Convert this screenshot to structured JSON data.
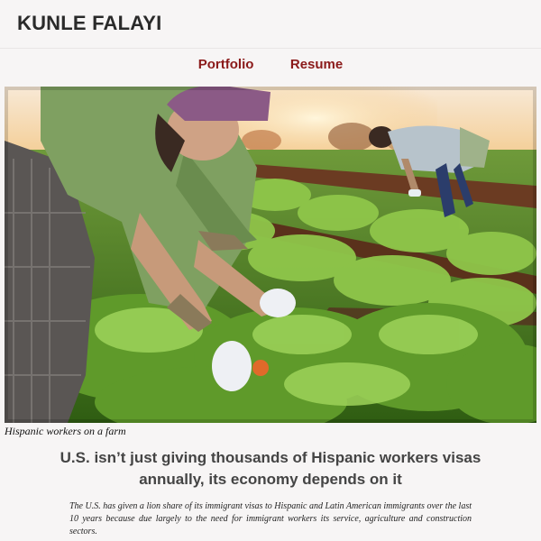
{
  "site": {
    "title": "KUNLE FALAYI"
  },
  "nav": {
    "items": [
      {
        "label": "Portfolio"
      },
      {
        "label": "Resume"
      }
    ]
  },
  "article": {
    "image_caption": "Hispanic workers on a farm",
    "headline": "U.S. isn’t just giving thousands of Hispanic workers visas annually, its economy depends on it",
    "lede": "The U.S. has given a lion share of its immigrant visas to Hispanic and Latin American immigrants over the last 10 years because due largely to the need for immigrant workers its service, agriculture and construction sectors."
  },
  "colors": {
    "background": "#f7f5f5",
    "nav_link": "#8b1a1a",
    "title": "#2a2a2a"
  }
}
